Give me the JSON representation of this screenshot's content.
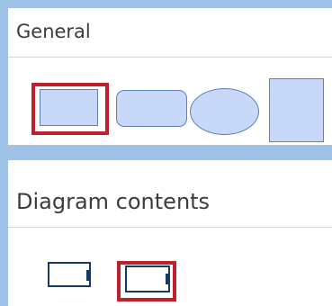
{
  "sections": {
    "general": {
      "title": "General"
    },
    "diagram_contents": {
      "title": "Diagram contents"
    }
  },
  "general_shapes": [
    "rectangle",
    "rounded-rectangle",
    "ellipse",
    "square"
  ],
  "diagram_items": [
    "frame-item-1",
    "frame-item-2"
  ],
  "colors": {
    "background": "#9fc3e6",
    "panel": "#ffffff",
    "shape_fill": "#c7d8f8",
    "shape_stroke": "#5b7fc0",
    "selection": "#c0202d",
    "frame_stroke": "#153a66"
  }
}
